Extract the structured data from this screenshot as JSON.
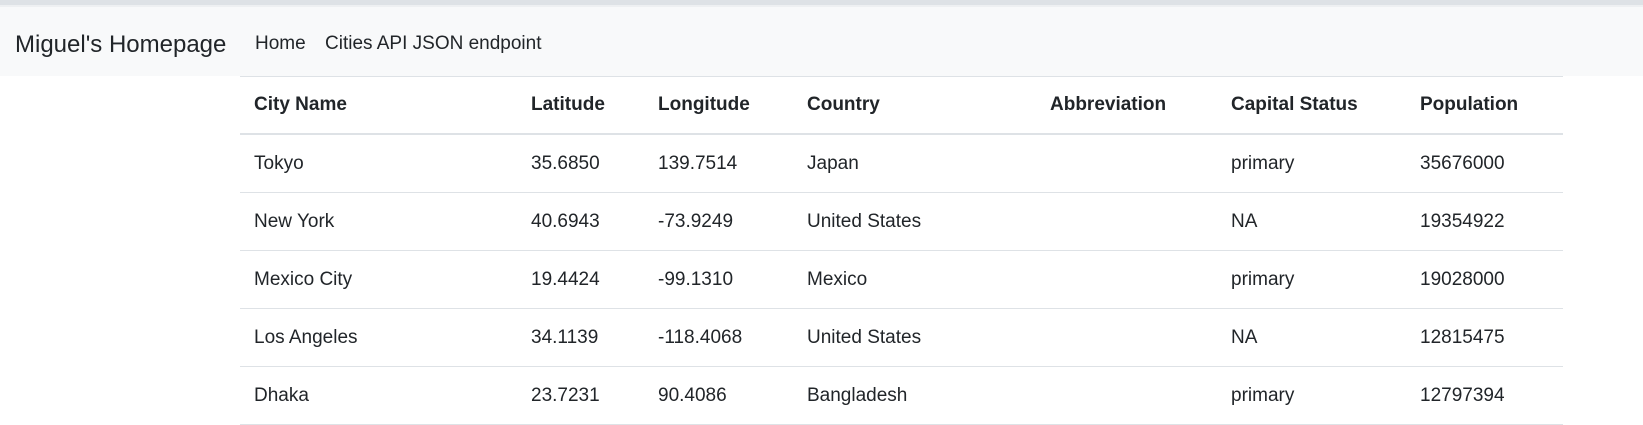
{
  "navbar": {
    "brand": "Miguel's Homepage",
    "links": [
      "Home",
      "Cities API JSON endpoint"
    ]
  },
  "table": {
    "headers": [
      "City Name",
      "Latitude",
      "Longitude",
      "Country",
      "Abbreviation",
      "Capital Status",
      "Population"
    ],
    "rows": [
      [
        "Tokyo",
        "35.6850",
        "139.7514",
        "Japan",
        "",
        "primary",
        "35676000"
      ],
      [
        "New York",
        "40.6943",
        "-73.9249",
        "United States",
        "",
        "NA",
        "19354922"
      ],
      [
        "Mexico City",
        "19.4424",
        "-99.1310",
        "Mexico",
        "",
        "primary",
        "19028000"
      ],
      [
        "Los Angeles",
        "34.1139",
        "-118.4068",
        "United States",
        "",
        "NA",
        "12815475"
      ],
      [
        "Dhaka",
        "23.7231",
        "90.4086",
        "Bangladesh",
        "",
        "primary",
        "12797394"
      ]
    ]
  }
}
